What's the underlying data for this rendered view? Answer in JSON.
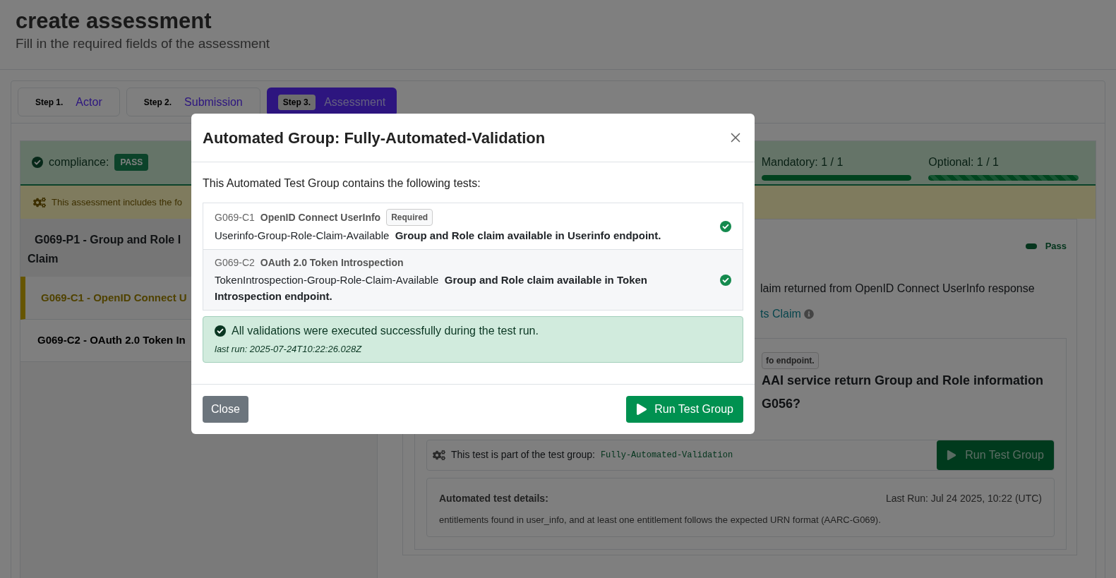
{
  "page": {
    "title": "create assessment",
    "subtitle": "Fill in the required fields of the assessment"
  },
  "steps": [
    {
      "step": "Step 1.",
      "label": "Actor",
      "selected": false
    },
    {
      "step": "Step 2.",
      "label": "Submission",
      "selected": false
    },
    {
      "step": "Step 3.",
      "label": "Assessment",
      "selected": true
    }
  ],
  "compliance": {
    "label": "compliance:",
    "badge": "PASS",
    "progress": [
      {
        "label": "Mandatory: 1 / 1",
        "level": 1,
        "kind": "solid"
      },
      {
        "label": "Optional: 1 / 1",
        "level": 1,
        "kind": "striped"
      }
    ]
  },
  "notice": "This assessment includes the fo",
  "principle": {
    "title_lines": [
      "G069-P1 - Group and Role I",
      "Claim"
    ],
    "criteria": [
      {
        "label": "G069-C1 - OpenID Connect U",
        "selected": true
      },
      {
        "label": "G069-C2 - OAuth 2.0 Token In",
        "selected": false
      }
    ]
  },
  "detail": {
    "status": "Pass",
    "description": "laim returned from OpenID Connect UserInfo response",
    "link": "ts Claim",
    "badge": "fo endpoint.",
    "question_lines": [
      "AAI service return Group and Role information",
      "G056?"
    ],
    "group_text": "This test is part of the test group:",
    "group_name": "Fully-Automated-Validation",
    "run_button": "Run Test Group",
    "details_title": "Automated test details:",
    "last_run": "Last Run: Jul 24 2025, 10:22 (UTC)",
    "details_text": "entitlements found in user_info, and at least one entitlement follows the expected URN format (AARC-G069)."
  },
  "modal": {
    "title": "Automated Group: Fully-Automated-Validation",
    "intro": "This Automated Test Group contains the following tests:",
    "tests": [
      {
        "code": "G069-C1",
        "name": "OpenID Connect UserInfo",
        "badge": "Required",
        "id": "Userinfo-Group-Role-Claim-Available",
        "description": "Group and Role claim available in Userinfo endpoint.",
        "passed": true
      },
      {
        "code": "G069-C2",
        "name": "OAuth 2.0 Token Introspection",
        "id": "TokenIntrospection-Group-Role-Claim-Available",
        "description": "Group and Role claim available in Token Introspection endpoint.",
        "passed": true
      }
    ],
    "alert": {
      "message": "All validations were executed successfully during the test run.",
      "last_run": "last run: 2025-07-24T10:22:26.028Z"
    },
    "close_button": "Close",
    "run_button": "Run Test Group"
  }
}
